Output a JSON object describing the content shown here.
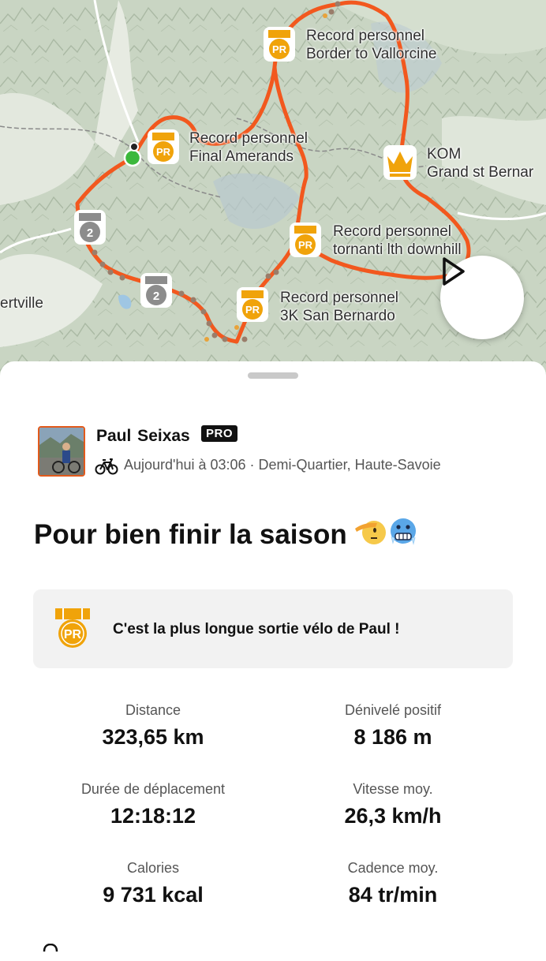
{
  "map": {
    "labels": [
      {
        "title": "Record personnel",
        "subtitle": "Border to Vallorcine"
      },
      {
        "title": "Record personnel",
        "subtitle": "Final Amerands"
      },
      {
        "title": "KOM",
        "subtitle": "Grand st Bernar"
      },
      {
        "title": "Record personnel",
        "subtitle": "tornanti lth downhill"
      },
      {
        "title": "Record personnel",
        "subtitle": "3K San Bernardo"
      }
    ],
    "place_label": "ertville",
    "badge_pr": "PR",
    "badge_rank": "2",
    "route_color": "#f2581e",
    "pr_gold": "#f0a30a"
  },
  "activity": {
    "athlete_name": "Paul  Seixas",
    "pro_label": "PRO",
    "meta": "Aujourd'hui à 03:06 · Demi-Quartier, Haute-Savoie",
    "title": "Pour bien finir la saison",
    "title_emojis": [
      "saluting-face",
      "cold-face"
    ],
    "pr_card_text": "C'est la plus longue sortie vélo de Paul  !",
    "pr_card_badge": "PR"
  },
  "stats": [
    {
      "label": "Distance",
      "value": "323,65 km"
    },
    {
      "label": "Dénivelé positif",
      "value": "8 186 m"
    },
    {
      "label": "Durée de déplacement",
      "value": "12:18:12"
    },
    {
      "label": "Vitesse moy.",
      "value": "26,3 km/h"
    },
    {
      "label": "Calories",
      "value": "9 731 kcal"
    },
    {
      "label": "Cadence moy.",
      "value": "84 tr/min"
    }
  ]
}
